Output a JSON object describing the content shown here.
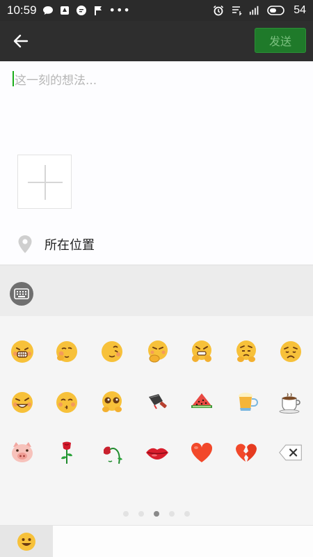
{
  "status_bar": {
    "time": "10:59",
    "battery": "54",
    "icons": [
      "chat-bubble-icon",
      "notification-icon",
      "message-icon",
      "flag-icon",
      "alarm-icon",
      "signal-icon",
      "battery-icon"
    ]
  },
  "title_bar": {
    "back_icon": "arrow-left-icon",
    "send_label": "发送"
  },
  "compose": {
    "placeholder": "这一刻的想法...",
    "location_label": "所在位置"
  },
  "keyboard": {
    "icon": "keyboard-icon"
  },
  "emoji_panel": {
    "rows": [
      [
        "grin-teeth",
        "shy-blush",
        "tongue-face",
        "hand-over-mouth-laugh",
        "grimace-hands",
        "worried-sweat",
        "sad-frown"
      ],
      [
        "squint-smirk",
        "kiss-face",
        "starry-eyes",
        "cleaver",
        "watermelon",
        "beer-mug",
        "coffee-cup"
      ],
      [
        "pig-face",
        "rose",
        "wilted-rose",
        "lips",
        "heart",
        "broken-heart",
        "delete-key"
      ]
    ],
    "page_count": 5,
    "active_page": 3
  },
  "tabs": {
    "active": "emoji-tab"
  },
  "colors": {
    "status_bar": "#2b2b2b",
    "title_bar": "#2e2e2e",
    "send_button": "#1f7a2a",
    "accent_green": "#1aad19"
  }
}
